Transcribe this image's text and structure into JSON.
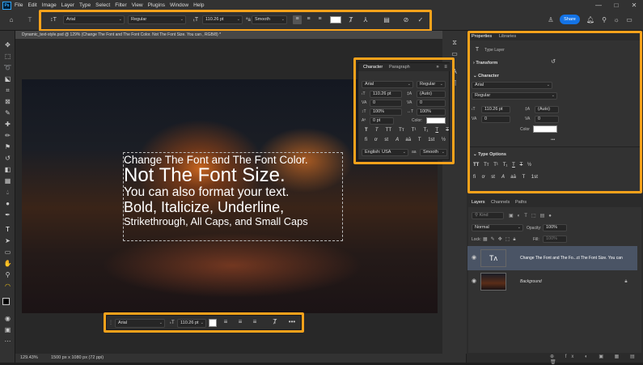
{
  "app": {
    "logo": "Ps",
    "menu": [
      "File",
      "Edit",
      "Image",
      "Layer",
      "Type",
      "Select",
      "Filter",
      "View",
      "Plugins",
      "Window",
      "Help"
    ],
    "window_controls": [
      "—",
      "□",
      "✕"
    ]
  },
  "options_bar": {
    "font_family": "Arial",
    "font_style": "Regular",
    "font_size": "110.26 pt",
    "antialias": "Smooth",
    "share_label": "Share"
  },
  "document": {
    "tab_title": "Dynamic_text-style.psd @ 129% (Change The Font and The Font Color. Not The Font Size. You can , RGB/8) *",
    "zoom": "129.43%",
    "dimensions": "1500 px x 1080 px (72 ppi)"
  },
  "text_layer": {
    "line1": "Change The Font and The Font Color.",
    "line2": "Not The Font Size.",
    "line3": "You can also format your text.",
    "line4": "Bold, Italicize, Underline,",
    "line5": "Strikethrough, All Caps, and Small Caps"
  },
  "character_panel": {
    "tabs": [
      "Character",
      "Paragraph"
    ],
    "font_family": "Arial",
    "font_style": "Regular",
    "size": "110.26 pt",
    "leading": "(Auto)",
    "kerning": "0",
    "tracking": "0",
    "vscale": "100%",
    "hscale": "100%",
    "baseline": "0 pt",
    "color_label": "Color:",
    "type_buttons": [
      "T",
      "T",
      "TT",
      "Tт",
      "T¹",
      "T₁",
      "T",
      "T"
    ],
    "language": "English: USA",
    "aa_label": "aa",
    "antialias": "Smooth"
  },
  "properties_panel": {
    "tabs": [
      "Properties",
      "Libraries"
    ],
    "layer_type": "Type Layer",
    "transform_label": "Transform",
    "character_label": "Character",
    "font_family": "Arial",
    "font_style": "Regular",
    "size": "110.26 pt",
    "leading": "(Auto)",
    "kerning": "0",
    "tracking": "0",
    "color_label": "Color",
    "more": "•••",
    "type_options_label": "Type Options"
  },
  "layers_panel": {
    "tabs": [
      "Layers",
      "Channels",
      "Paths"
    ],
    "search_placeholder": "Kind",
    "blend_mode": "Normal",
    "opacity_label": "Opacity:",
    "opacity": "100%",
    "lock_label": "Lock:",
    "fill_label": "Fill:",
    "fill": "100%",
    "layers": [
      {
        "name": "Change The Font and The Fo...ct The Font Size. You can",
        "type": "text"
      },
      {
        "name": "Background",
        "type": "image"
      }
    ]
  },
  "context_bar": {
    "font_family": "Arial",
    "font_size": "110.26 pt",
    "more": "•••"
  },
  "colors": {
    "highlight": "#f7a21b",
    "accent": "#1473e6",
    "panel_bg": "#323232"
  }
}
